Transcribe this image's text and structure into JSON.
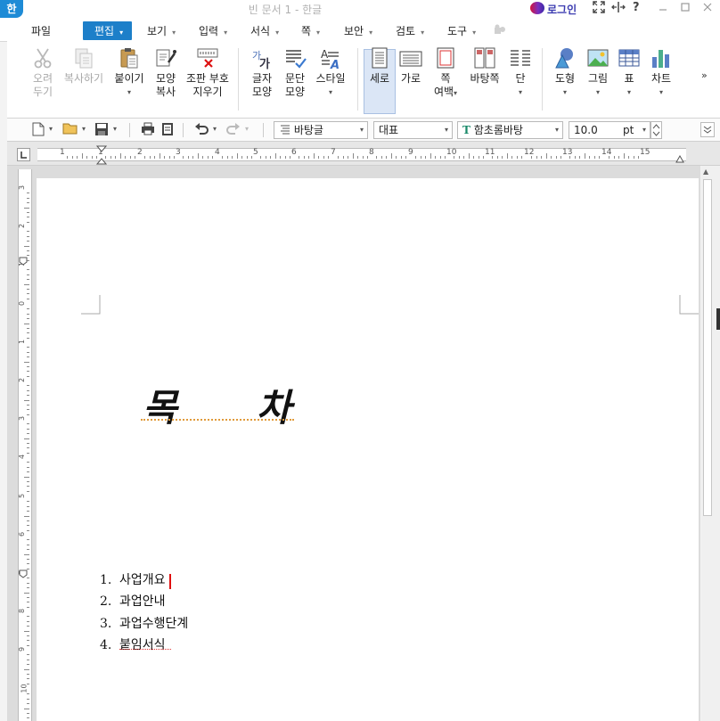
{
  "app": {
    "logo": "한",
    "window_title": "빈 문서 1 - 한글",
    "login": "로그인",
    "title_icons": [
      "fullscreen-icon",
      "width-fit-icon",
      "help-icon"
    ],
    "help_glyph": "?"
  },
  "menu": {
    "items": [
      {
        "label": "파일",
        "caret": false
      },
      {
        "label": "편집",
        "caret": true,
        "active": true
      },
      {
        "label": "보기",
        "caret": true
      },
      {
        "label": "입력",
        "caret": true
      },
      {
        "label": "서식",
        "caret": true
      },
      {
        "label": "쪽",
        "caret": true
      },
      {
        "label": "보안",
        "caret": true
      },
      {
        "label": "검토",
        "caret": true
      },
      {
        "label": "도구",
        "caret": true
      }
    ],
    "caret_glyph": "▾"
  },
  "ribbon": {
    "cut": {
      "line1": "오려",
      "line2": "두기"
    },
    "copy": {
      "line1": "복사하기"
    },
    "paste": {
      "line1": "붙이기"
    },
    "format_copy": {
      "line1": "모양",
      "line2": "복사"
    },
    "clear_marks": {
      "line1": "조판 부호",
      "line2": "지우기"
    },
    "char_shape": {
      "line1": "글자",
      "line2": "모양"
    },
    "para_shape": {
      "line1": "문단",
      "line2": "모양"
    },
    "style": {
      "line1": "스타일"
    },
    "portrait": {
      "line1": "세로"
    },
    "landscape": {
      "line1": "가로"
    },
    "margin": {
      "line1": "쪽",
      "line2": "여백"
    },
    "background": {
      "line1": "바탕쪽"
    },
    "columns": {
      "line1": "단"
    },
    "shape": {
      "line1": "도형"
    },
    "picture": {
      "line1": "그림"
    },
    "table": {
      "line1": "표"
    },
    "chart": {
      "line1": "차트"
    },
    "more": "»"
  },
  "format_bar": {
    "style": "바탕글",
    "lang": "대표",
    "font": "함초롬바탕",
    "font_icon": "T",
    "size": "10.0",
    "unit": "pt"
  },
  "ruler": {
    "h_labels": [
      "1",
      "1",
      "2",
      "3",
      "4",
      "5",
      "6",
      "7",
      "8",
      "9",
      "10",
      "11",
      "12",
      "13",
      "14",
      "15"
    ],
    "v_labels": [
      "3",
      "2",
      "1",
      "0",
      "1",
      "2",
      "3",
      "4",
      "5",
      "6",
      "7",
      "8",
      "9",
      "10"
    ]
  },
  "document": {
    "title_chars": [
      "목",
      "차"
    ],
    "toc": [
      {
        "num": "1.",
        "text": "사업개요"
      },
      {
        "num": "2.",
        "text": "과업안내"
      },
      {
        "num": "3.",
        "text": "과업수행단계"
      },
      {
        "num": "4.",
        "text": "붙임서식"
      }
    ]
  },
  "colors": {
    "accent": "#1d7fc9",
    "cursor": "#e01010",
    "logo_bg": "#1e8bd6"
  }
}
